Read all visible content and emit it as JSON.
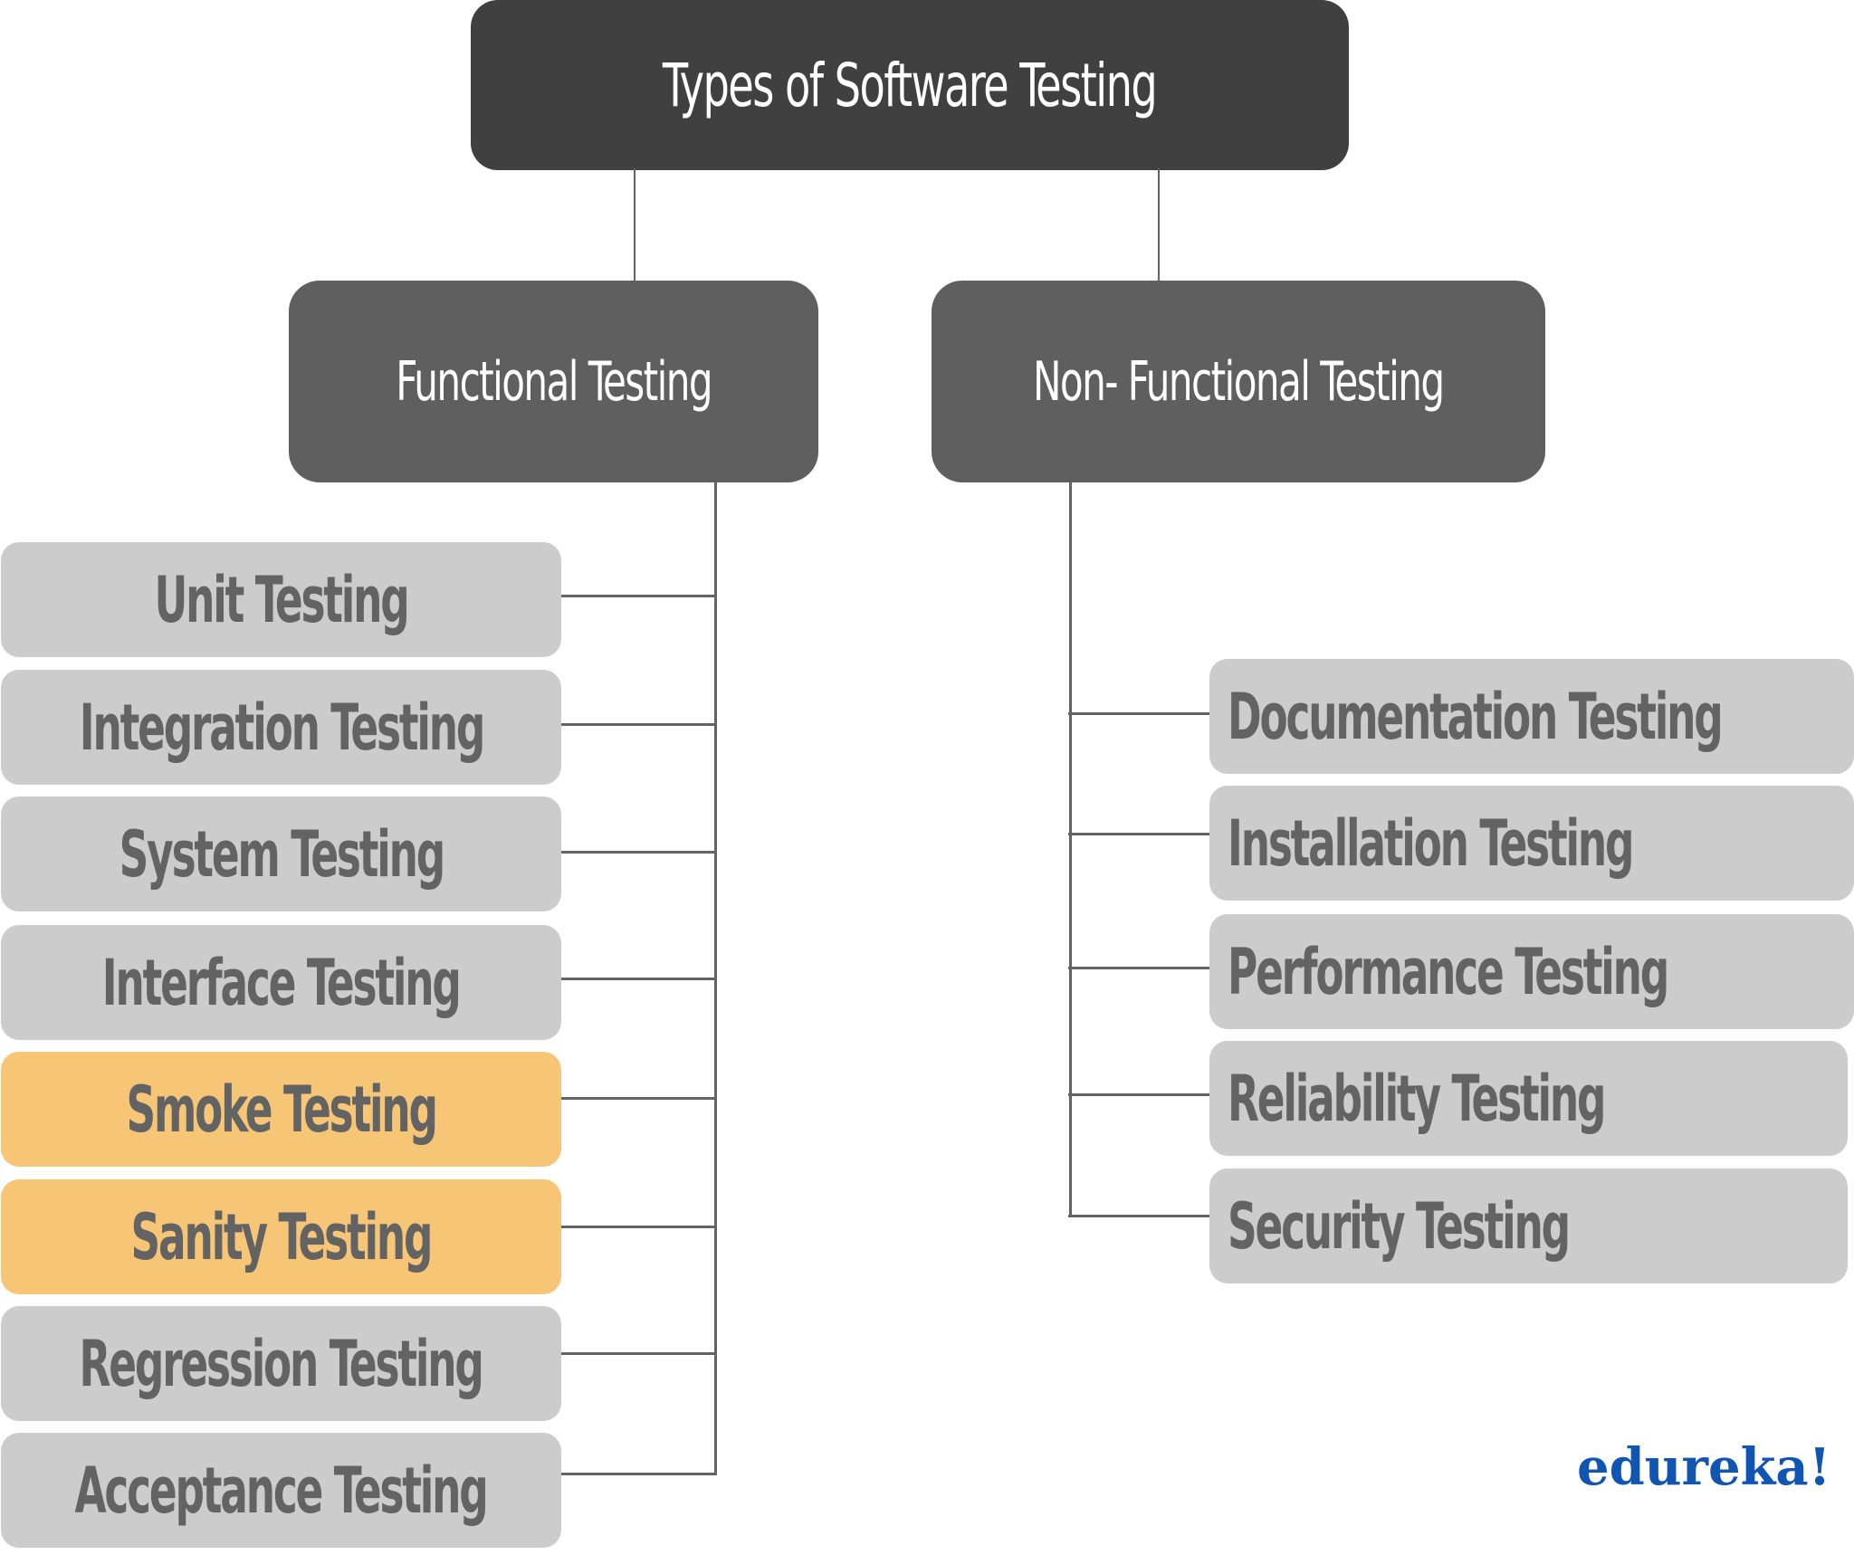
{
  "title": "Types of Software Testing",
  "categories": {
    "functional": {
      "label": "Functional Testing",
      "items": [
        {
          "label": "Unit Testing",
          "highlighted": false
        },
        {
          "label": "Integration Testing",
          "highlighted": false
        },
        {
          "label": "System Testing",
          "highlighted": false
        },
        {
          "label": "Interface Testing",
          "highlighted": false
        },
        {
          "label": "Smoke Testing",
          "highlighted": true
        },
        {
          "label": "Sanity Testing",
          "highlighted": true
        },
        {
          "label": "Regression Testing",
          "highlighted": false
        },
        {
          "label": "Acceptance Testing",
          "highlighted": false
        }
      ]
    },
    "non_functional": {
      "label": "Non- Functional Testing",
      "items": [
        {
          "label": "Documentation Testing",
          "highlighted": false
        },
        {
          "label": "Installation Testing",
          "highlighted": false
        },
        {
          "label": "Performance Testing",
          "highlighted": false
        },
        {
          "label": "Reliability Testing",
          "highlighted": false
        },
        {
          "label": "Security Testing",
          "highlighted": false
        }
      ]
    }
  },
  "colors": {
    "root": "#404040",
    "category": "#5f5f5f",
    "leaf": "#cccccc",
    "highlight": "#f6c576",
    "leaf_text": "#636363",
    "logo": "#1155b3"
  },
  "logo": "edureka!"
}
